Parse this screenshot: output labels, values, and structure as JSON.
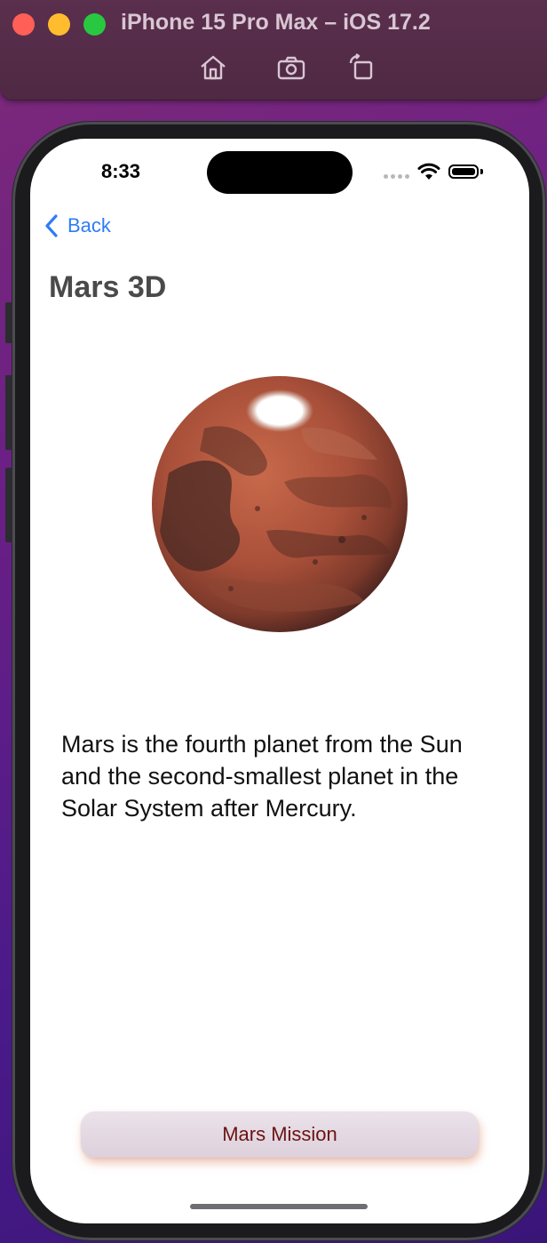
{
  "window": {
    "title": "iPhone 15 Pro Max – iOS 17.2",
    "toolbar_icons": [
      "home-icon",
      "screenshot-icon",
      "rotate-icon"
    ]
  },
  "status_bar": {
    "time": "8:33",
    "icons": [
      "cellular-dots-icon",
      "wifi-icon",
      "battery-icon"
    ]
  },
  "nav": {
    "back_label": "Back",
    "title": "Mars 3D"
  },
  "content": {
    "model": "mars-globe-icon",
    "description": "Mars is the fourth planet from the Sun and the second-smallest planet in the Solar System after Mercury."
  },
  "actions": {
    "mission_label": "Mars Mission"
  },
  "colors": {
    "accent": "#2f7cf6",
    "mission_text": "#6a1412",
    "title_text": "#4a4a4a"
  }
}
